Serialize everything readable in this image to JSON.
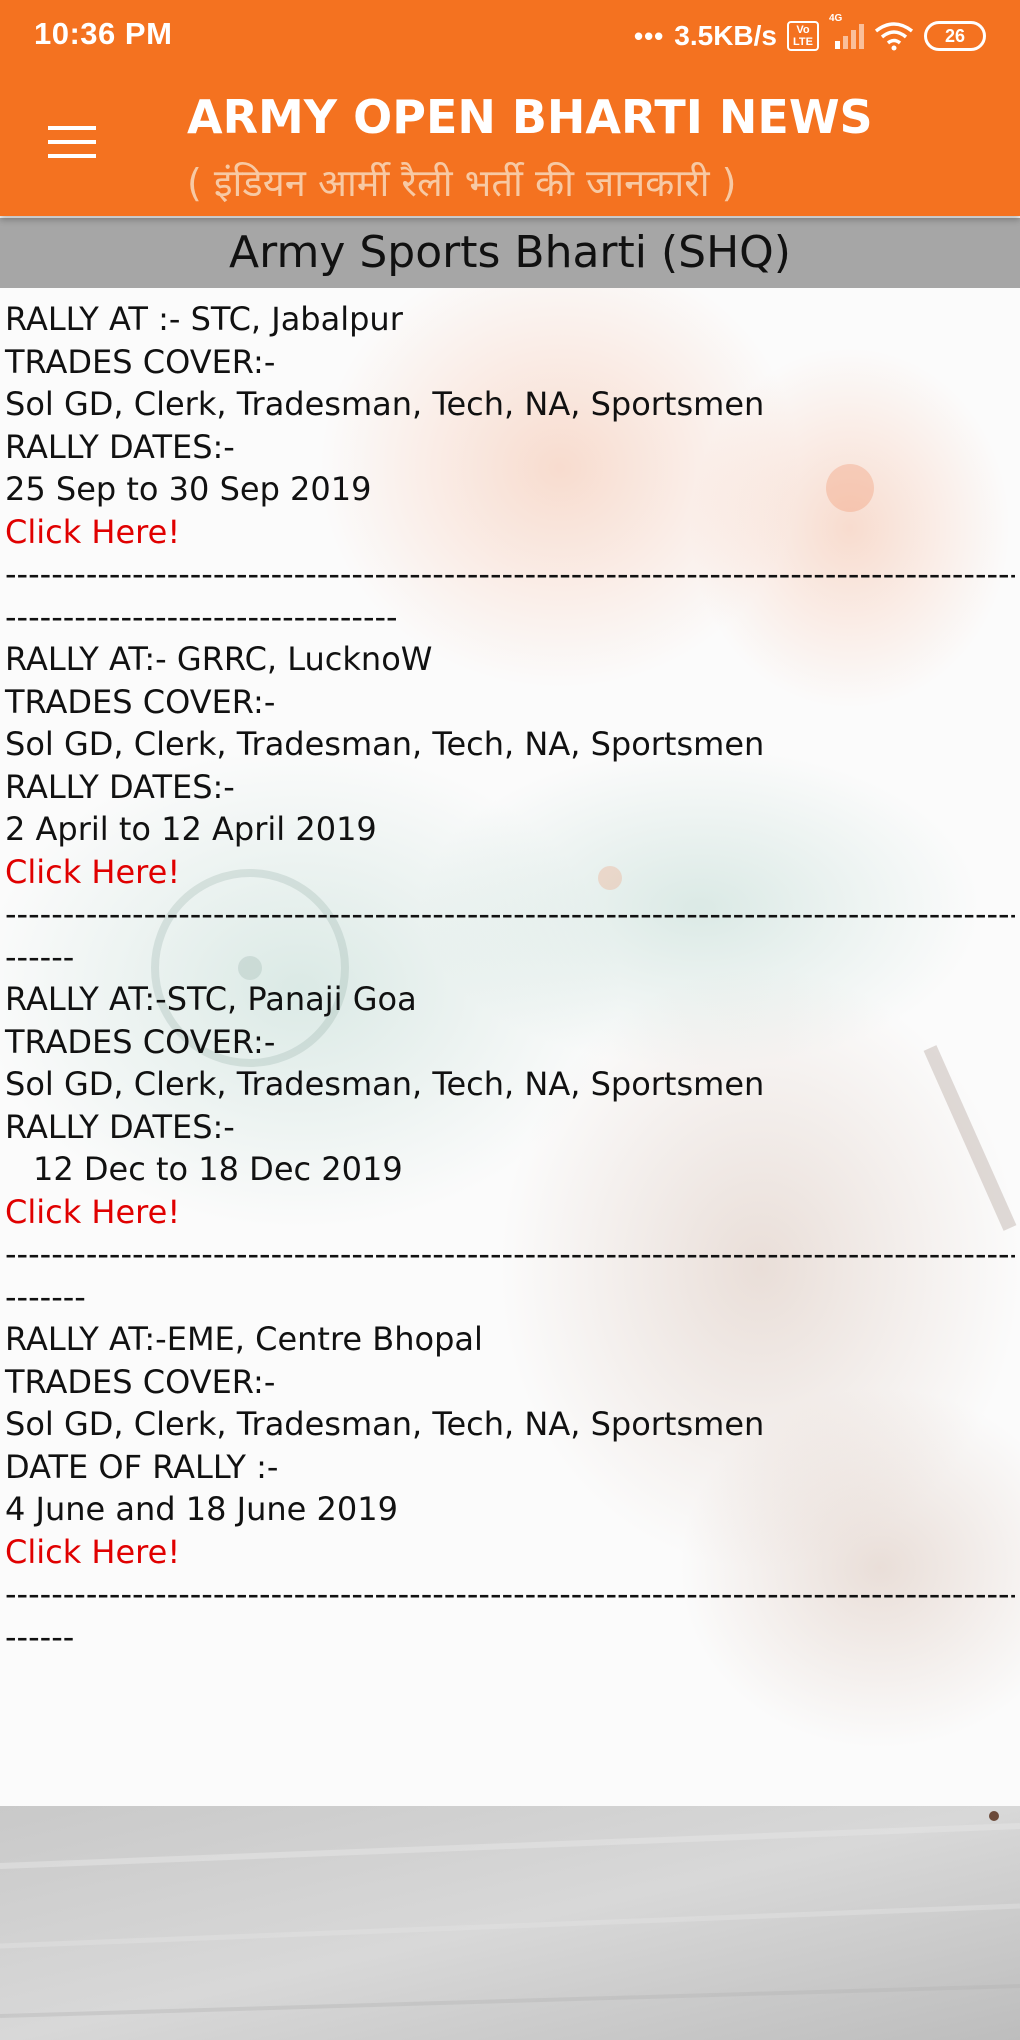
{
  "status_bar": {
    "time": "10:36 PM",
    "dots": "•••",
    "net_speed": "3.5KB/s",
    "volte": "Vo LTE",
    "network": "4G",
    "battery": "26"
  },
  "app_bar": {
    "title": "ARMY OPEN BHARTI NEWS",
    "subtitle": "( इंडियन आर्मी रैली भर्ती की जानकारी )",
    "menu_icon": "hamburger-menu-icon",
    "background_color": "#f47220"
  },
  "section": {
    "title": "Army Sports Bharti (SHQ)"
  },
  "rallies": [
    {
      "rally_at": "RALLY AT :- STC, Jabalpur",
      "trades_label": "TRADES COVER:-",
      "trades": "Sol GD, Clerk, Tradesman, Tech, NA, Sportsmen",
      "dates_label": "RALLY DATES:-",
      "dates": "25 Sep to 30 Sep 2019",
      "link": "Click Here!",
      "separator_1": "---------------------------------------------------------------------------------------------------",
      "separator_2": "----------------------------------"
    },
    {
      "rally_at": "RALLY AT:- GRRC, LucknoW",
      "trades_label": "TRADES COVER:-",
      "trades": "Sol GD, Clerk, Tradesman, Tech, NA, Sportsmen",
      "dates_label": "RALLY DATES:-",
      "dates": "2 April to 12 April 2019",
      "link": "Click Here!",
      "separator_1": "---------------------------------------------------------------------------------------------------",
      "separator_2": "------"
    },
    {
      "rally_at": "RALLY AT:-STC, Panaji Goa",
      "trades_label": "TRADES COVER:-",
      "trades": "Sol GD, Clerk, Tradesman, Tech, NA, Sportsmen",
      "dates_label": "RALLY DATES:-",
      "dates": "12 Dec to 18 Dec 2019",
      "link": "Click Here!",
      "separator_1": "---------------------------------------------------------------------------------------------------",
      "separator_2": "-------"
    },
    {
      "rally_at": "RALLY AT:-EME, Centre Bhopal",
      "trades_label": "TRADES COVER:-",
      "trades": "Sol GD, Clerk, Tradesman, Tech, NA, Sportsmen",
      "dates_label": "DATE OF RALLY :-",
      "dates": "4 June and 18 June 2019",
      "link": "Click Here!",
      "separator_1": "---------------------------------------------------------------------------------------------------",
      "separator_2": "------"
    }
  ],
  "colors": {
    "link": "#e00000",
    "header_bar": "#a6a6a6"
  }
}
